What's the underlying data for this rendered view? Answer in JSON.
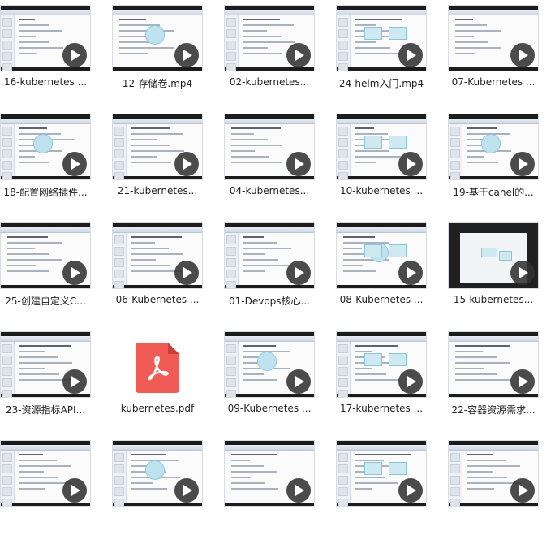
{
  "files": [
    {
      "name": "16-kubernetes ...",
      "kind": "video"
    },
    {
      "name": "12-存储卷.mp4",
      "kind": "video"
    },
    {
      "name": "02-kubernetes...",
      "kind": "video"
    },
    {
      "name": "24-helm入门.mp4",
      "kind": "video"
    },
    {
      "name": "07-Kubernetes ...",
      "kind": "video"
    },
    {
      "name": "18-配置网络插件...",
      "kind": "video"
    },
    {
      "name": "21-kubernetes...",
      "kind": "video"
    },
    {
      "name": "04-kubernetes...",
      "kind": "video"
    },
    {
      "name": "10-kubernetes ...",
      "kind": "video"
    },
    {
      "name": "19-基于canel的...",
      "kind": "video"
    },
    {
      "name": "25-创建自定义C...",
      "kind": "video"
    },
    {
      "name": "06-Kubernetes ...",
      "kind": "video"
    },
    {
      "name": "01-Devops核心...",
      "kind": "video"
    },
    {
      "name": "08-Kubernetes ...",
      "kind": "video"
    },
    {
      "name": "15-kubernetes...",
      "kind": "video"
    },
    {
      "name": "23-资源指标API...",
      "kind": "video"
    },
    {
      "name": "kubernetes.pdf",
      "kind": "pdf"
    },
    {
      "name": "09-Kubernetes ...",
      "kind": "video"
    },
    {
      "name": "17-kubernetes ...",
      "kind": "video"
    },
    {
      "name": "22-容器资源需求...",
      "kind": "video"
    },
    {
      "name": "",
      "kind": "video"
    },
    {
      "name": "",
      "kind": "video"
    },
    {
      "name": "",
      "kind": "video"
    },
    {
      "name": "",
      "kind": "video"
    },
    {
      "name": "",
      "kind": "video"
    }
  ],
  "icons": {
    "play": "play-icon",
    "pdf": "pdf-file-icon"
  },
  "colors": {
    "pdf_red": "#f05b56",
    "play_overlay": "#323232"
  }
}
